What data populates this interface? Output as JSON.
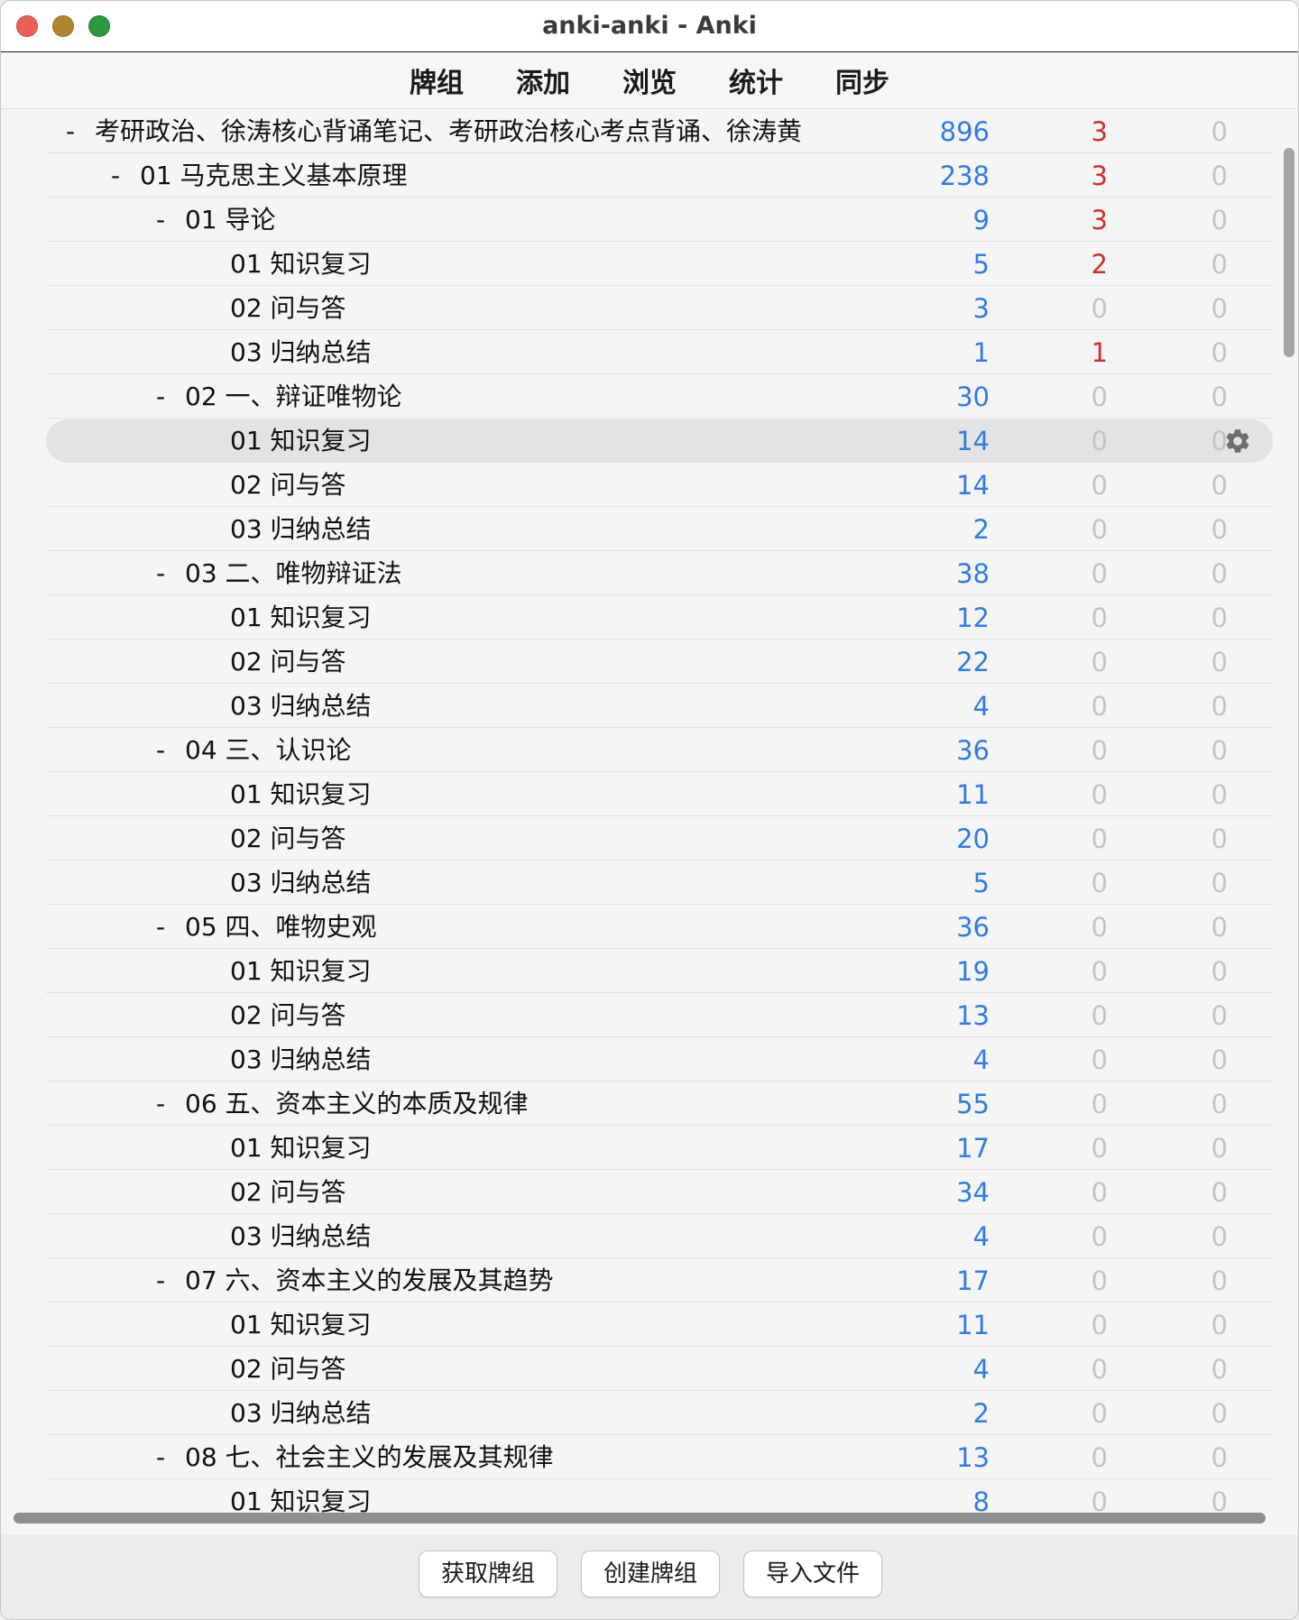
{
  "window": {
    "title": "anki-anki - Anki"
  },
  "toolbar": {
    "tabs": [
      "牌组",
      "添加",
      "浏览",
      "统计",
      "同步"
    ]
  },
  "colors": {
    "new": "#2f7ce8",
    "learn": "#d0312d",
    "zero": "#c4c4c4"
  },
  "decks": [
    {
      "level": 0,
      "collapse": "-",
      "name": "考研政治、徐涛核心背诵笔记、考研政治核心考点背诵、徐涛黄",
      "new": "896",
      "learn": "3",
      "review": "0"
    },
    {
      "level": 1,
      "collapse": "-",
      "name": "01 马克思主义基本原理",
      "new": "238",
      "learn": "3",
      "review": "0"
    },
    {
      "level": 2,
      "collapse": "-",
      "name": "01 导论",
      "new": "9",
      "learn": "3",
      "review": "0"
    },
    {
      "level": 3,
      "collapse": "",
      "name": "01 知识复习",
      "new": "5",
      "learn": "2",
      "review": "0"
    },
    {
      "level": 3,
      "collapse": "",
      "name": "02 问与答",
      "new": "3",
      "learn": "0",
      "review": "0"
    },
    {
      "level": 3,
      "collapse": "",
      "name": "03 归纳总结",
      "new": "1",
      "learn": "1",
      "review": "0"
    },
    {
      "level": 2,
      "collapse": "-",
      "name": "02 一、辩证唯物论",
      "new": "30",
      "learn": "0",
      "review": "0"
    },
    {
      "level": 3,
      "collapse": "",
      "name": "01 知识复习",
      "new": "14",
      "learn": "0",
      "review": "0",
      "current": true
    },
    {
      "level": 3,
      "collapse": "",
      "name": "02 问与答",
      "new": "14",
      "learn": "0",
      "review": "0"
    },
    {
      "level": 3,
      "collapse": "",
      "name": "03 归纳总结",
      "new": "2",
      "learn": "0",
      "review": "0"
    },
    {
      "level": 2,
      "collapse": "-",
      "name": "03 二、唯物辩证法",
      "new": "38",
      "learn": "0",
      "review": "0"
    },
    {
      "level": 3,
      "collapse": "",
      "name": "01 知识复习",
      "new": "12",
      "learn": "0",
      "review": "0"
    },
    {
      "level": 3,
      "collapse": "",
      "name": "02 问与答",
      "new": "22",
      "learn": "0",
      "review": "0"
    },
    {
      "level": 3,
      "collapse": "",
      "name": "03 归纳总结",
      "new": "4",
      "learn": "0",
      "review": "0"
    },
    {
      "level": 2,
      "collapse": "-",
      "name": "04 三、认识论",
      "new": "36",
      "learn": "0",
      "review": "0"
    },
    {
      "level": 3,
      "collapse": "",
      "name": "01 知识复习",
      "new": "11",
      "learn": "0",
      "review": "0"
    },
    {
      "level": 3,
      "collapse": "",
      "name": "02 问与答",
      "new": "20",
      "learn": "0",
      "review": "0"
    },
    {
      "level": 3,
      "collapse": "",
      "name": "03 归纳总结",
      "new": "5",
      "learn": "0",
      "review": "0"
    },
    {
      "level": 2,
      "collapse": "-",
      "name": "05 四、唯物史观",
      "new": "36",
      "learn": "0",
      "review": "0"
    },
    {
      "level": 3,
      "collapse": "",
      "name": "01 知识复习",
      "new": "19",
      "learn": "0",
      "review": "0"
    },
    {
      "level": 3,
      "collapse": "",
      "name": "02 问与答",
      "new": "13",
      "learn": "0",
      "review": "0"
    },
    {
      "level": 3,
      "collapse": "",
      "name": "03 归纳总结",
      "new": "4",
      "learn": "0",
      "review": "0"
    },
    {
      "level": 2,
      "collapse": "-",
      "name": "06 五、资本主义的本质及规律",
      "new": "55",
      "learn": "0",
      "review": "0"
    },
    {
      "level": 3,
      "collapse": "",
      "name": "01 知识复习",
      "new": "17",
      "learn": "0",
      "review": "0"
    },
    {
      "level": 3,
      "collapse": "",
      "name": "02 问与答",
      "new": "34",
      "learn": "0",
      "review": "0"
    },
    {
      "level": 3,
      "collapse": "",
      "name": "03 归纳总结",
      "new": "4",
      "learn": "0",
      "review": "0"
    },
    {
      "level": 2,
      "collapse": "-",
      "name": "07 六、资本主义的发展及其趋势",
      "new": "17",
      "learn": "0",
      "review": "0"
    },
    {
      "level": 3,
      "collapse": "",
      "name": "01 知识复习",
      "new": "11",
      "learn": "0",
      "review": "0"
    },
    {
      "level": 3,
      "collapse": "",
      "name": "02 问与答",
      "new": "4",
      "learn": "0",
      "review": "0"
    },
    {
      "level": 3,
      "collapse": "",
      "name": "03 归纳总结",
      "new": "2",
      "learn": "0",
      "review": "0"
    },
    {
      "level": 2,
      "collapse": "-",
      "name": "08 七、社会主义的发展及其规律",
      "new": "13",
      "learn": "0",
      "review": "0"
    },
    {
      "level": 3,
      "collapse": "",
      "name": "01 知识复习",
      "new": "8",
      "learn": "0",
      "review": "0"
    }
  ],
  "icons": {
    "options": "gear-icon"
  },
  "buttons": {
    "get_shared": "获取牌组",
    "create": "创建牌组",
    "import": "导入文件"
  }
}
